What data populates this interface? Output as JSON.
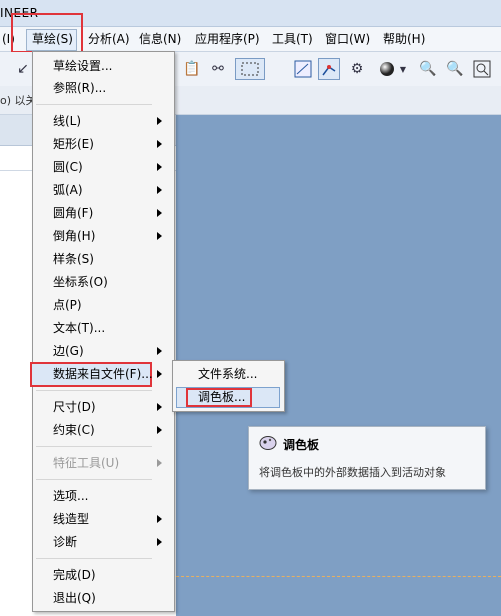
{
  "app": {
    "title": "INEER"
  },
  "menubar": {
    "items": [
      {
        "label": "(I)"
      },
      {
        "label": "草绘(S)"
      },
      {
        "label": "分析(A)"
      },
      {
        "label": "信息(N)"
      },
      {
        "label": "应用程序(P)"
      },
      {
        "label": "工具(T)"
      },
      {
        "label": "窗口(W)"
      },
      {
        "label": "帮助(H)"
      }
    ]
  },
  "strip2": {
    "text": "o) 以关"
  },
  "sketch_menu": {
    "items": [
      {
        "label": "草绘设置..."
      },
      {
        "label": "参照(R)..."
      },
      {
        "label": "线(L)"
      },
      {
        "label": "矩形(E)"
      },
      {
        "label": "圆(C)"
      },
      {
        "label": "弧(A)"
      },
      {
        "label": "圆角(F)"
      },
      {
        "label": "倒角(H)"
      },
      {
        "label": "样条(S)"
      },
      {
        "label": "坐标系(O)"
      },
      {
        "label": "点(P)"
      },
      {
        "label": "文本(T)..."
      },
      {
        "label": "边(G)"
      },
      {
        "label": "数据来自文件(F)..."
      },
      {
        "label": "尺寸(D)"
      },
      {
        "label": "约束(C)"
      },
      {
        "label": "特征工具(U)"
      },
      {
        "label": "选项..."
      },
      {
        "label": "线造型"
      },
      {
        "label": "诊断"
      },
      {
        "label": "完成(D)"
      },
      {
        "label": "退出(Q)"
      }
    ]
  },
  "submenu": {
    "items": [
      {
        "label": "文件系统..."
      },
      {
        "label": "调色板..."
      }
    ]
  },
  "tooltip": {
    "title": "调色板",
    "description": "将调色板中的外部数据插入到活动对象"
  },
  "colors": {
    "highlight": "#e0343a",
    "canvas": "#7f9fc4"
  }
}
